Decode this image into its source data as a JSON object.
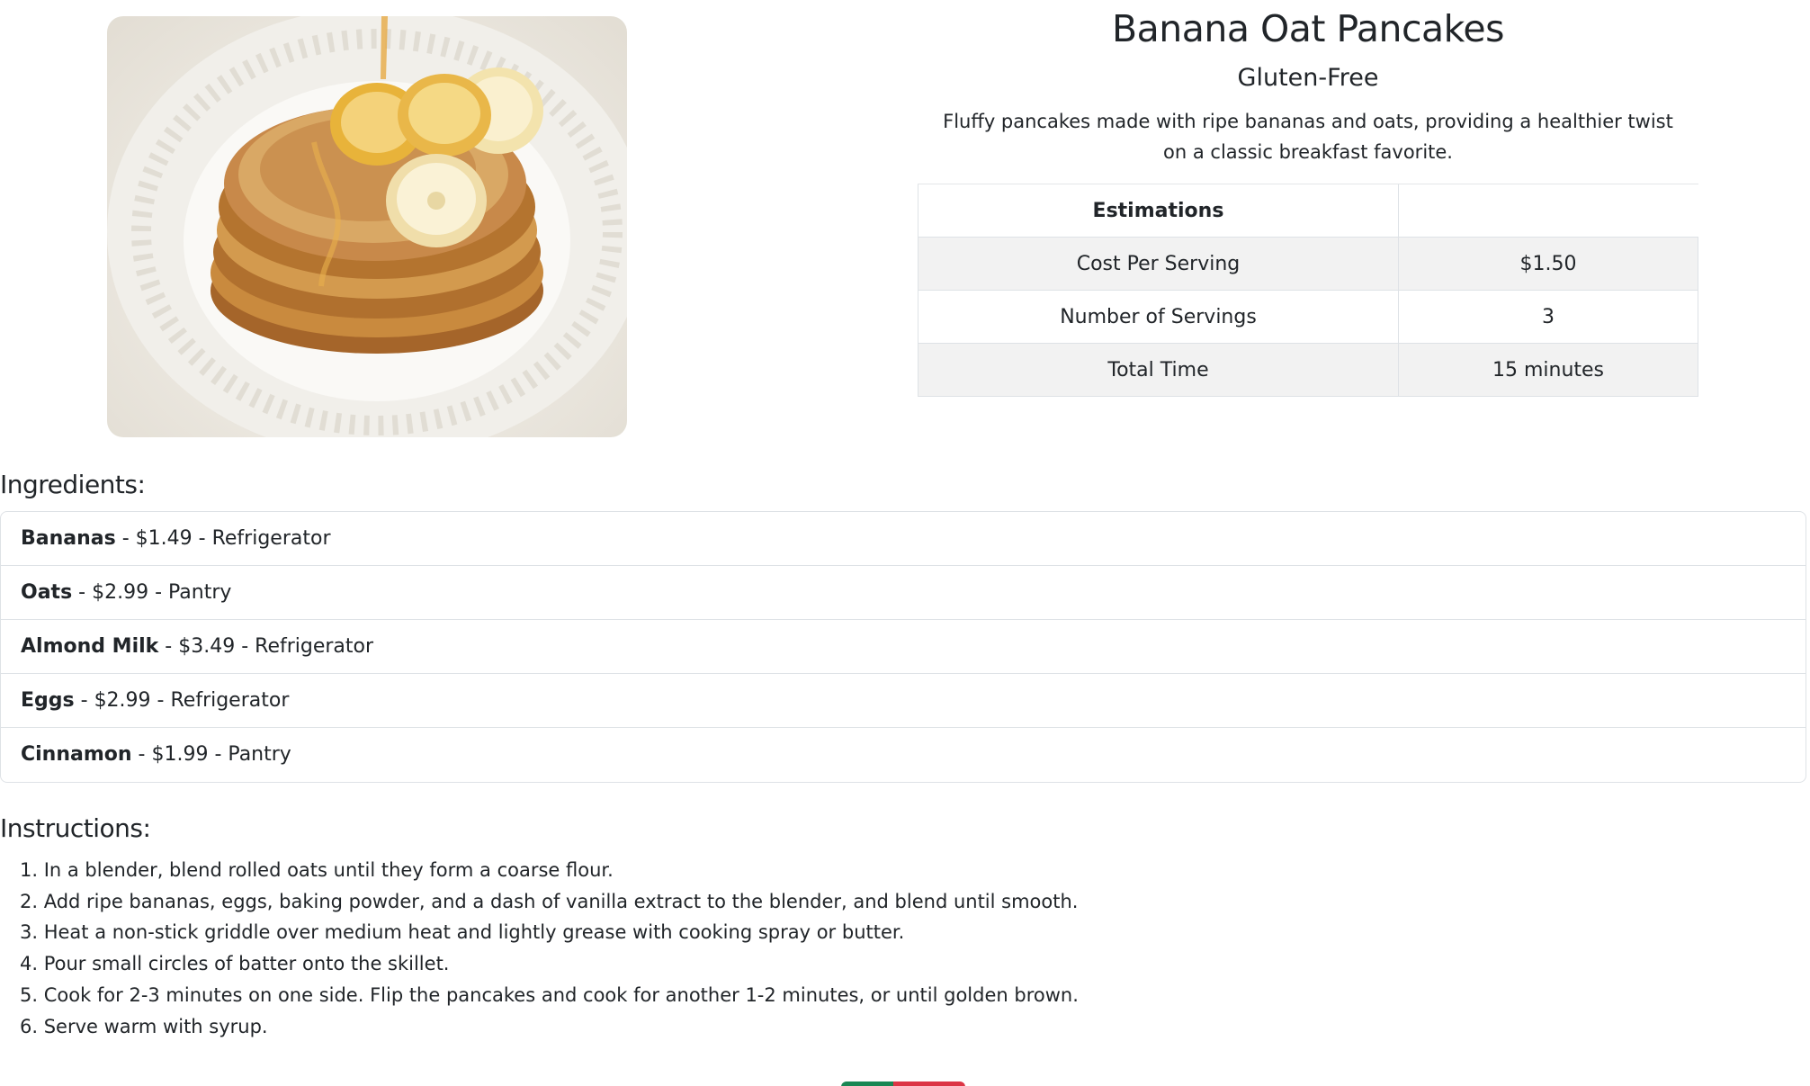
{
  "recipe": {
    "title": "Banana Oat Pancakes",
    "tag": "Gluten-Free",
    "description": "Fluffy pancakes made with ripe bananas and oats, providing a healthier twist on a classic breakfast favorite.",
    "image_alt": "banana oat pancakes stacked on a plate with banana slices and syrup"
  },
  "estimations": {
    "header": "Estimations",
    "header_value": "",
    "rows": [
      {
        "label": "Cost Per Serving",
        "value": "$1.50"
      },
      {
        "label": "Number of Servings",
        "value": "3"
      },
      {
        "label": "Total Time",
        "value": "15 minutes"
      }
    ]
  },
  "ingredients": {
    "heading": "Ingredients:",
    "items": [
      {
        "name": "Bananas",
        "price": "$1.49",
        "location": "Refrigerator"
      },
      {
        "name": "Oats",
        "price": "$2.99",
        "location": "Pantry"
      },
      {
        "name": "Almond Milk",
        "price": "$3.49",
        "location": "Refrigerator"
      },
      {
        "name": "Eggs",
        "price": "$2.99",
        "location": "Refrigerator"
      },
      {
        "name": "Cinnamon",
        "price": "$1.99",
        "location": "Pantry"
      }
    ]
  },
  "instructions": {
    "heading": "Instructions:",
    "steps": [
      "1. In a blender, blend rolled oats until they form a coarse flour.",
      "2. Add ripe bananas, eggs, baking powder, and a dash of vanilla extract to the blender, and blend until smooth.",
      "3. Heat a non-stick griddle over medium heat and lightly grease with cooking spray or butter.",
      "4. Pour small circles of batter onto the skillet.",
      "5. Cook for 2-3 minutes on one side. Flip the pancakes and cook for another 1-2 minutes, or until golden brown.",
      "6. Serve warm with syrup."
    ]
  },
  "actions": {
    "edit_color": "#198754",
    "delete_color": "#dc3545"
  }
}
